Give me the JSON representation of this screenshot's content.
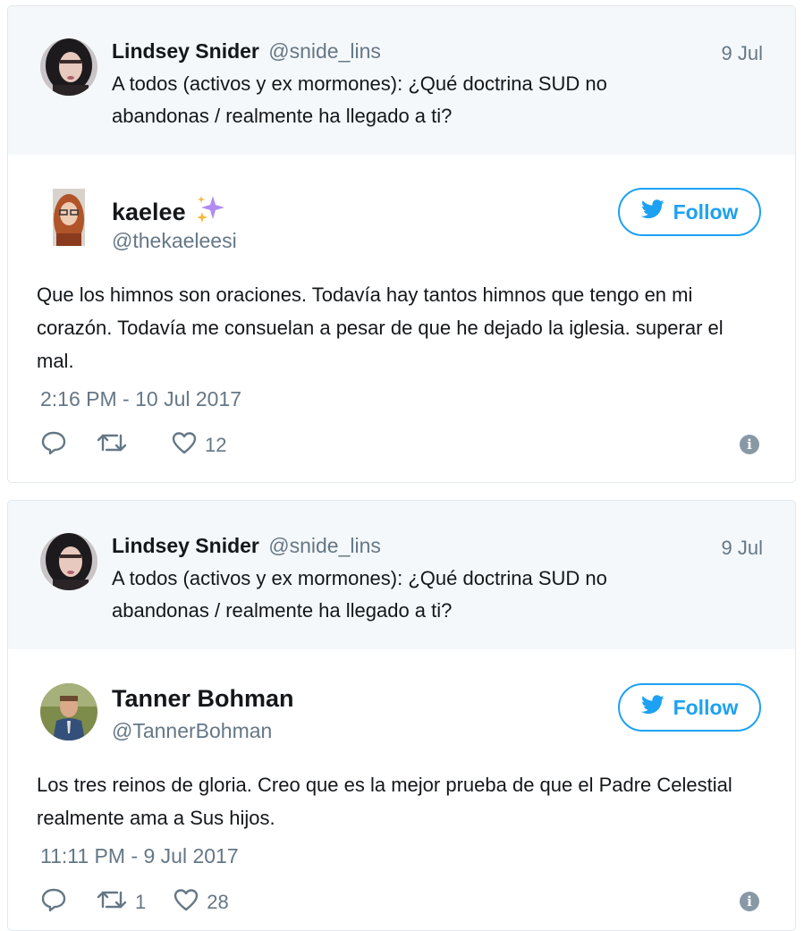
{
  "tweets": [
    {
      "parent": {
        "name": "Lindsey Snider",
        "handle": "@snide_lins",
        "date": "9 Jul",
        "text": "A todos (activos y ex mormones): ¿Qué doctrina SUD no abandonas / realmente ha llegado a ti?"
      },
      "reply": {
        "name": "kaelee",
        "name_emoji": "sparkles-icon",
        "handle": "@thekaeleesi",
        "follow_label": "Follow",
        "text": "Que los himnos son oraciones. Todavía hay tantos himnos que tengo en mi corazón. Todavía me consuelan a pesar de que he dejado la iglesia. superar el mal.",
        "timestamp": "2:16 PM - 10 Jul 2017",
        "retweets": "",
        "likes": "12"
      }
    },
    {
      "parent": {
        "name": "Lindsey Snider",
        "handle": "@snide_lins",
        "date": "9 Jul",
        "text": "A todos (activos y ex mormones): ¿Qué doctrina SUD no abandonas / realmente ha llegado a ti?"
      },
      "reply": {
        "name": "Tanner Bohman",
        "handle": "@TannerBohman",
        "follow_label": "Follow",
        "text": "Los tres reinos de gloria. Creo que es la mejor prueba de que el Padre Celestial realmente ama a Sus hijos.",
        "timestamp": "11:11 PM - 9 Jul 2017",
        "retweets": "1",
        "likes": "28"
      }
    }
  ],
  "colors": {
    "accent": "#1da1f2",
    "muted": "#657786",
    "parent_bg": "#f5f8fa",
    "border": "#e1e8ed"
  }
}
